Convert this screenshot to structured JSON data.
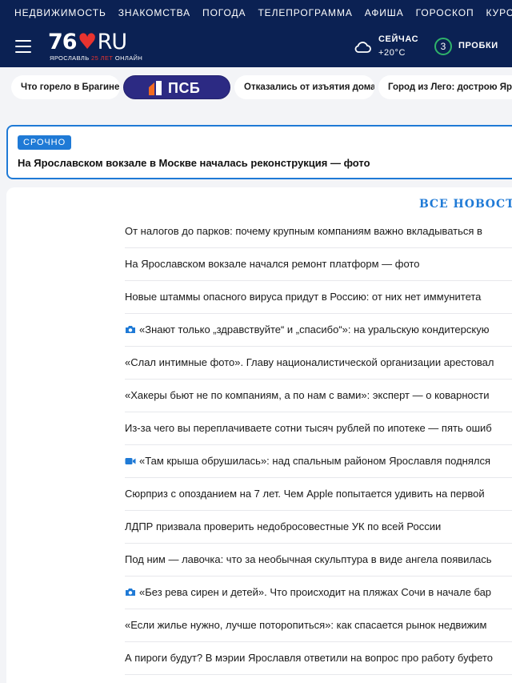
{
  "top_nav": [
    "НЕДВИЖИМОСТЬ",
    "ЗНАКОМСТВА",
    "ПОГОДА",
    "ТЕЛЕПРОГРАММА",
    "АФИША",
    "ГОРОСКОП",
    "КУРСЫ ВАЛЮТ"
  ],
  "logo": {
    "number": "76",
    "suffix": "RU",
    "city": "ЯРОСЛАВЛЬ",
    "anniversary": "25 ЛЕТ",
    "online": "ОНЛАЙН"
  },
  "weather": {
    "label": "СЕЙЧАС",
    "temp": "+20°С",
    "icon": "cloud-icon"
  },
  "traffic": {
    "level": "3",
    "label": "ПРОБКИ"
  },
  "chips": [
    "Что горело в Брагине",
    "ПСБ",
    "Отказались от изъятия дома",
    "Город из Лего: дострою Ярославль"
  ],
  "urgent": {
    "badge": "СРОЧНО",
    "title": "На Ярославском вокзале в Москве началась реконструкция — фото"
  },
  "news_header": "ВСЕ НОВОСТИ",
  "news": [
    {
      "icon": "",
      "text": "От налогов до парков: почему крупным компаниям важно вкладываться в"
    },
    {
      "icon": "",
      "text": "На Ярославском вокзале начался ремонт платформ — фото"
    },
    {
      "icon": "",
      "text": "Новые штаммы опасного вируса придут в Россию: от них нет иммунитета"
    },
    {
      "icon": "camera-icon",
      "text": "«Знают только „здравствуйте“ и „спасибо“»: на уральскую кондитерскую"
    },
    {
      "icon": "",
      "text": "«Слал интимные фото». Главу националистической организации арестовал"
    },
    {
      "icon": "",
      "text": "«Хакеры бьют не по компаниям, а по нам с вами»: эксперт — о коварности"
    },
    {
      "icon": "",
      "text": "Из-за чего вы переплачиваете сотни тысяч рублей по ипотеке — пять ошиб"
    },
    {
      "icon": "video-icon",
      "text": "«Там крыша обрушилась»: над спальным районом Ярославля поднялся"
    },
    {
      "icon": "",
      "text": "Сюрприз с опозданием на 7 лет. Чем Apple попытается удивить на первой"
    },
    {
      "icon": "",
      "text": "ЛДПР призвала проверить недобросовестные УК по всей России"
    },
    {
      "icon": "",
      "text": "Под ним — лавочка: что за необычная скульптура в виде ангела появилась"
    },
    {
      "icon": "camera-icon",
      "text": "«Без рева сирен и детей». Что происходит на пляжах Сочи в начале бар"
    },
    {
      "icon": "",
      "text": "«Если жилье нужно, лучше поторопиться»: как спасается рынок недвижим"
    },
    {
      "icon": "",
      "text": "А пироги будут? В мэрии Ярославля ответили на вопрос про работу буфето"
    }
  ],
  "colors": {
    "header_bg": "#0b2153",
    "accent": "#1f7ad6",
    "logo_red": "#e8332f",
    "psb_bg": "#2c2a83",
    "traffic_green": "#2fb36a"
  }
}
